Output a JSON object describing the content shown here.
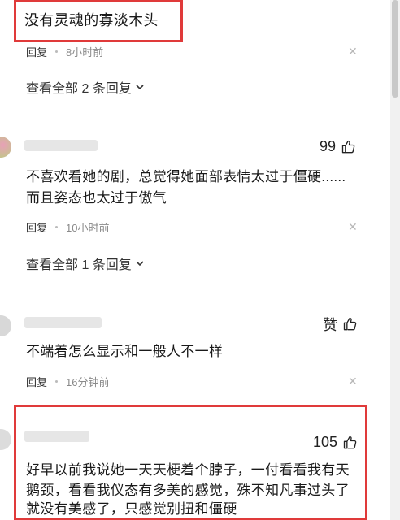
{
  "comments": [
    {
      "text": "没有灵魂的寡淡木头",
      "reply_label": "回复",
      "time": "8小时前",
      "expand_label": "查看全部 2 条回复"
    },
    {
      "likes": "99",
      "text_line1": "不喜欢看她的剧，总觉得她面部表情太过于僵硬......",
      "text_line2": "而且姿态也太过于傲气",
      "reply_label": "回复",
      "time": "10小时前",
      "expand_label": "查看全部 1 条回复"
    },
    {
      "likes": "赞",
      "text": "不端着怎么显示和一般人不一样",
      "reply_label": "回复",
      "time": "16分钟前"
    },
    {
      "likes": "105",
      "text_line1": "好早以前我说她一天天梗着个脖子，一付看看我有天",
      "text_line2": "鹅颈，看看我仪态有多美的感觉，殊不知凡事过头了",
      "text_line3": "就没有美感了，只感觉别扭和僵硬"
    }
  ],
  "icons": {
    "like": "thumbs-up-icon",
    "close": "close-icon",
    "chevron": "chevron-down-icon"
  },
  "colors": {
    "highlight": "#e03a3a",
    "meta": "#8a8a8a"
  }
}
